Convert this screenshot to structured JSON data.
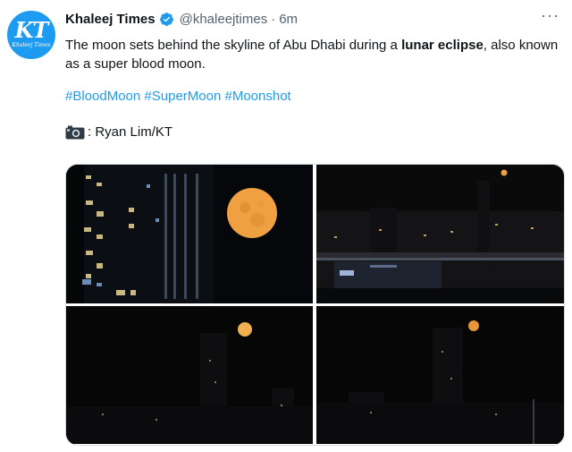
{
  "author": {
    "name": "Khaleej Times",
    "handle": "@khaleejtimes",
    "separator": "·",
    "time": "6m",
    "avatar_text": "KT",
    "avatar_subtext": "Khaleej Times"
  },
  "tweet": {
    "text_before": "The moon sets behind the skyline of Abu Dhabi during a ",
    "text_bold": "lunar eclipse",
    "text_after": ", also known as a super blood moon.",
    "hashtags": [
      "#BloodMoon",
      "#SuperMoon",
      "#Moonshot"
    ],
    "credit": ": Ryan Lim/KT"
  },
  "icons": {
    "verified": "verified-badge-icon",
    "more": "more-options-icon",
    "camera": "camera-icon"
  },
  "more_glyph": "···",
  "colors": {
    "accent": "#1d9bf0",
    "text": "#0f1419",
    "secondary": "#536471",
    "moon": "#f0a040"
  }
}
